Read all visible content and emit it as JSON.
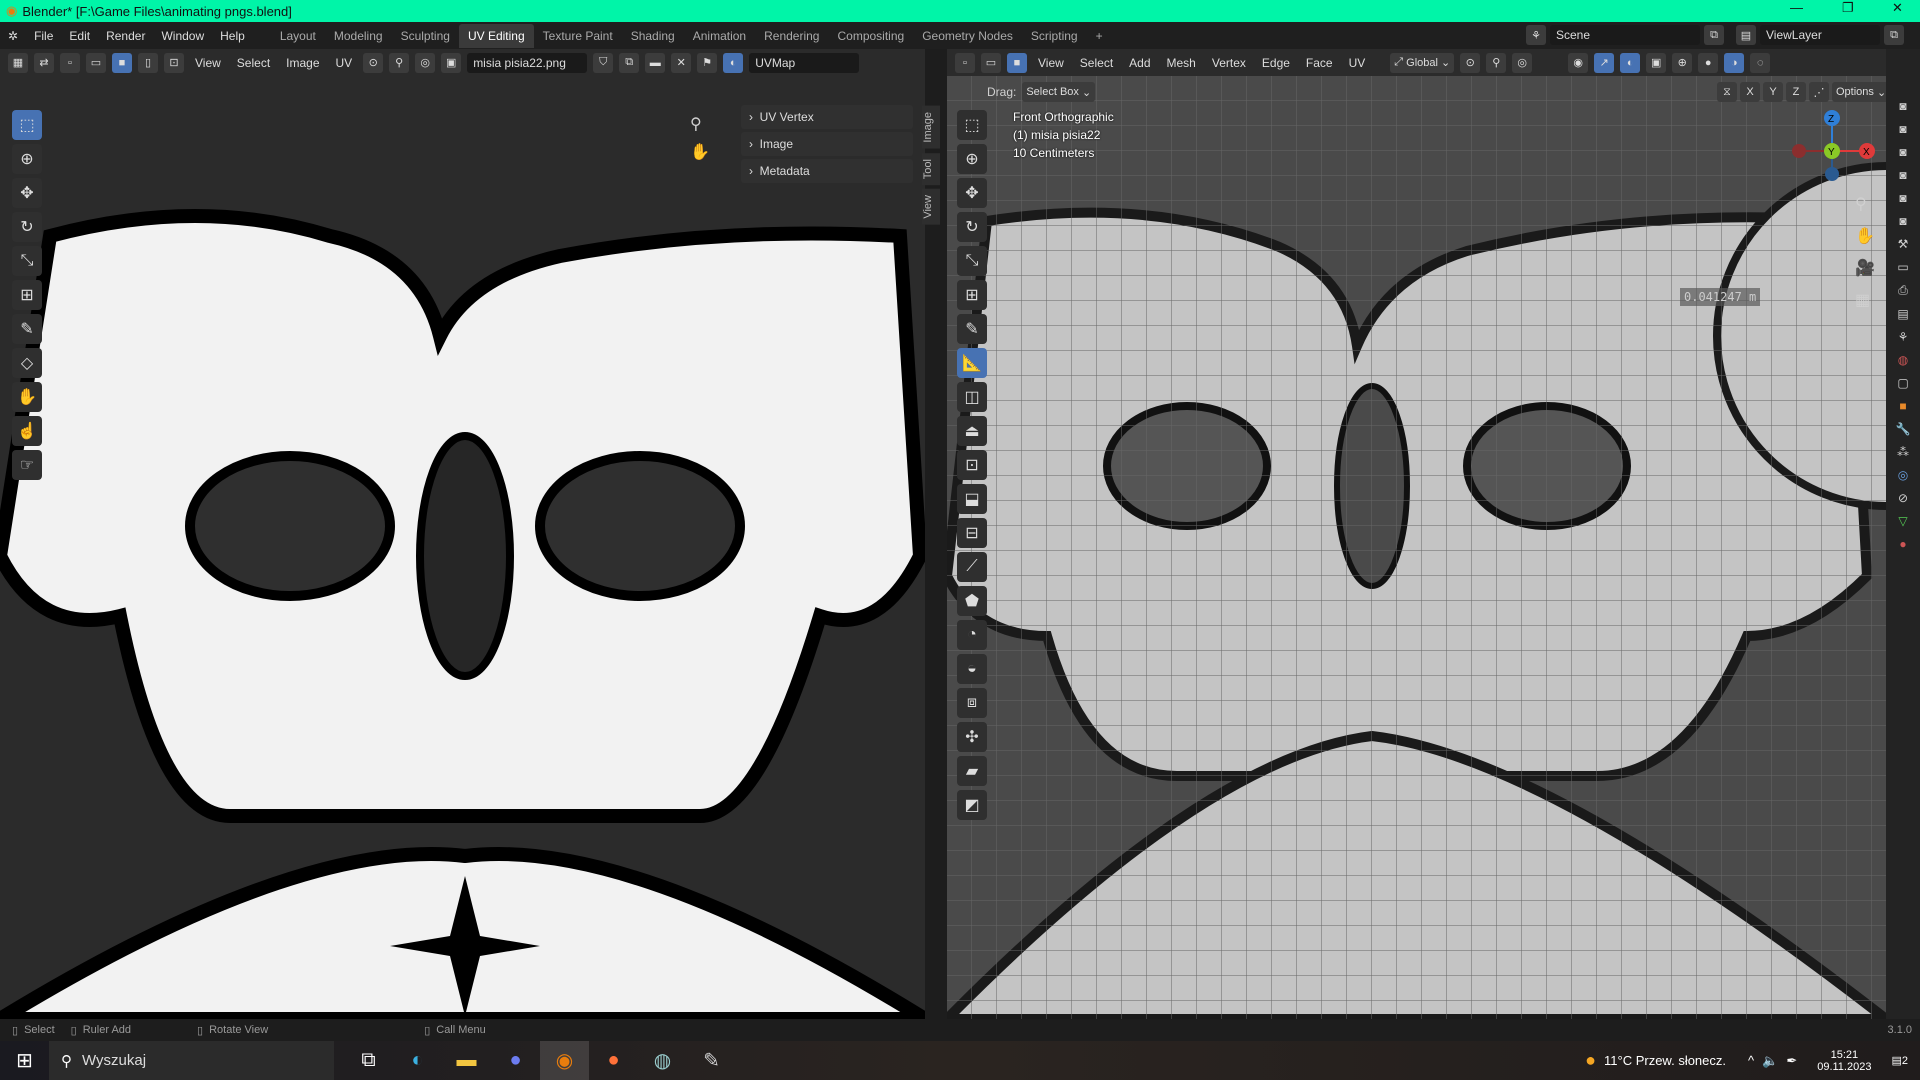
{
  "window": {
    "title": "Blender* [F:\\Game Files\\animating pngs.blend]",
    "controls": [
      "—",
      "❐",
      "✕"
    ]
  },
  "menu": {
    "items": [
      "File",
      "Edit",
      "Render",
      "Window",
      "Help"
    ]
  },
  "workspaces": {
    "tabs": [
      "Layout",
      "Modeling",
      "Sculpting",
      "UV Editing",
      "Texture Paint",
      "Shading",
      "Animation",
      "Rendering",
      "Compositing",
      "Geometry Nodes",
      "Scripting"
    ],
    "active": "UV Editing",
    "add": "+"
  },
  "scene": {
    "name": "Scene",
    "view_layer": "ViewLayer"
  },
  "uv_editor": {
    "menus": [
      "View",
      "Select",
      "Image",
      "UV"
    ],
    "image_name": "misia pisia22.png",
    "uv_map": "UVMap",
    "npanel": [
      "UV Vertex",
      "Image",
      "Metadata"
    ],
    "vtabs": [
      "Image",
      "Tool",
      "View"
    ]
  },
  "viewport": {
    "menus": [
      "View",
      "Select",
      "Add",
      "Mesh",
      "Vertex",
      "Edge",
      "Face",
      "UV"
    ],
    "orientation": "Global",
    "drag_label": "Drag:",
    "drag_value": "Select Box",
    "axes": [
      "X",
      "Y",
      "Z"
    ],
    "options": "Options",
    "overlay": [
      "Front Orthographic",
      "(1) misia pisia22",
      "10 Centimeters"
    ],
    "measure": "0.041247 m",
    "gizmo": {
      "z": "Z",
      "y": "Y",
      "x": "X"
    }
  },
  "status": {
    "items": [
      "Select",
      "Ruler Add",
      "Rotate View",
      "Call Menu"
    ],
    "version": "3.1.0"
  },
  "taskbar": {
    "search_placeholder": "Wyszukaj",
    "weather": "11°C  Przew. słonecz.",
    "time": "15:21",
    "date": "09.11.2023",
    "notifications": "2"
  },
  "colors": {
    "accent": "#4772b3",
    "titlebar": "#00f5a8"
  }
}
